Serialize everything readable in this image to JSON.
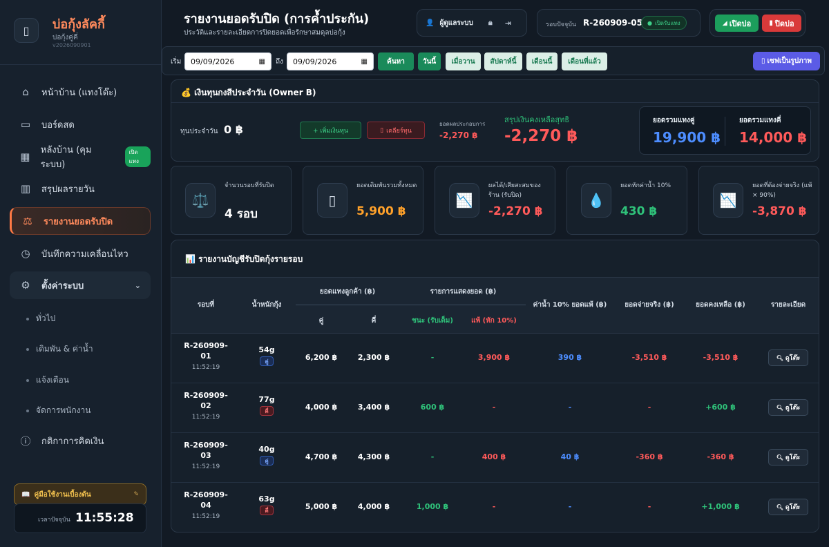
{
  "app": {
    "brand_name": "บ่อกุ้งลัคกี้",
    "brand_sub": "บ่อกุ้งคู่คี่",
    "version": "v2026090901"
  },
  "sidebar": {
    "items": [
      {
        "label": "หน้าบ้าน (แทงโต๊ะ)",
        "icon": "home-icon"
      },
      {
        "label": "บอร์ดสด",
        "icon": "monitor-icon"
      },
      {
        "label": "หลังบ้าน (คุมระบบ)",
        "icon": "layout-icon",
        "badge": "เปิดแทง"
      },
      {
        "label": "สรุปผลรายวัน",
        "icon": "bar-chart-icon"
      },
      {
        "label": "รายงานยอดรับปิด",
        "icon": "scale-icon"
      },
      {
        "label": "บันทึกความเคลื่อนไหว",
        "icon": "clock-icon"
      },
      {
        "label": "ตั้งค่าระบบ",
        "icon": "gear-icon"
      }
    ],
    "sub_items": [
      "ทั่วไป",
      "เดิมพัน & ค่าน้ำ",
      "แจ้งเตือน",
      "จัดการพนักงาน"
    ],
    "extra_item": {
      "label": "กติกาการคิดเงิน",
      "icon": "info-icon"
    },
    "guide_label": "คู่มือใช้งานเบื้องต้น",
    "clock_label": "เวลาปัจจุบัน",
    "clock_time": "11:55:28"
  },
  "header": {
    "title": "รายงานยอดรับปิด (การค้ำประกัน)",
    "subtitle": "ประวัติและรายละเอียดการปิดยอดเพื่อรักษาสมดุลบ่อกุ้ง",
    "user_label": "ผู้ดูแลระบบ",
    "round_label": "รอบปัจจุบัน",
    "round_id": "R-260909-05",
    "round_status": "เปิดรับแทง",
    "open_button": "เปิดบ่อ",
    "close_button": "ปิดบ่อ"
  },
  "filter": {
    "start_label": "เริ่ม",
    "start_date": "09/09/2026",
    "end_label": "ถึง",
    "end_date": "09/09/2026",
    "search_button": "ค้นหา",
    "quick": [
      "วันนี้",
      "เมื่อวาน",
      "สัปดาห์นี้",
      "เดือนนี้",
      "เดือนที่แล้ว"
    ],
    "save_button": "เซฟเป็นรูปภาพ"
  },
  "capital": {
    "title": "💰 เงินทุนกงสีประจำวัน (Owner B)",
    "daily_label": "ทุนประจำวัน",
    "daily_value": "0 ฿",
    "add_button": "+ เพิ่มเงินทุน",
    "clear_button": "เคลียร์ทุน",
    "op_label": "ยอดผลประกอบการ",
    "op_value": "-2,270 ฿",
    "net_label": "สรุปเงินคงเหลือสุทธิ",
    "net_value": "-2,270 ฿",
    "even_total_label": "ยอดรวมแทงคู่",
    "even_total_value": "19,900 ฿",
    "odd_total_label": "ยอดรวมแทงคี่",
    "odd_total_value": "14,000 ฿"
  },
  "stats": [
    {
      "label": "จำนวนรอบที่รับปิด",
      "value": "4 รอบ",
      "icon": "scale-icon"
    },
    {
      "label": "ยอดเดิมพันรวมทั้งหมด",
      "value": "5,900 ฿",
      "icon": "receipt-icon"
    },
    {
      "label": "ผลได้/เสียสะสมของร้าน (รับปิด)",
      "value": "-2,270 ฿",
      "icon": "chart-down-icon"
    },
    {
      "label": "ยอดหักค่าน้ำ 10%",
      "value": "430 ฿",
      "icon": "droplet-icon"
    },
    {
      "label": "ยอดที่ต้องจ่ายจริง (แพ้ × 90%)",
      "value": "-3,870 ฿",
      "icon": "chart-down-icon"
    }
  ],
  "table": {
    "title": "📊 รายงานบัญชีรับปิดกุ้งรายรอบ",
    "headers": {
      "round": "รอบที่",
      "weight": "น้ำหนักกุ้ง",
      "customer_group": "ยอดแทงลูกค้า (฿)",
      "even": "คู่",
      "odd": "คี่",
      "display_group": "รายการแสดงยอด (฿)",
      "win": "ชนะ (รับเต็ม)",
      "lose": "แพ้ (หัก 10%)",
      "commission": "ค่าน้ำ 10% ยอดแพ้ (฿)",
      "actual_pay": "ยอดจ่ายจริง (฿)",
      "balance": "ยอดคงเหลือ (฿)",
      "detail": "รายละเอียด"
    },
    "view_button": "ดูโต๊ะ",
    "rows": [
      {
        "round": "R-260909-",
        "round_no": "01",
        "time": "11:52:19",
        "weight": "54g",
        "parity": "คู่",
        "parity_type": "even",
        "even": "6,200 ฿",
        "odd": "2,300 ฿",
        "win": "-",
        "lose": "3,900 ฿",
        "commission": "390 ฿",
        "actual": "-3,510 ฿",
        "balance": "-3,510 ฿",
        "win_color": "green",
        "lose_color": "red",
        "comm_color": "blue",
        "actual_color": "red",
        "balance_color": "red"
      },
      {
        "round": "R-260909-",
        "round_no": "02",
        "time": "11:52:19",
        "weight": "77g",
        "parity": "คี่",
        "parity_type": "odd",
        "even": "4,000 ฿",
        "odd": "3,400 ฿",
        "win": "600 ฿",
        "lose": "-",
        "commission": "-",
        "actual": "-",
        "balance": "+600 ฿",
        "win_color": "green",
        "lose_color": "red",
        "comm_color": "blue",
        "actual_color": "red",
        "balance_color": "green"
      },
      {
        "round": "R-260909-",
        "round_no": "03",
        "time": "11:52:19",
        "weight": "40g",
        "parity": "คู่",
        "parity_type": "even",
        "even": "4,700 ฿",
        "odd": "4,300 ฿",
        "win": "-",
        "lose": "400 ฿",
        "commission": "40 ฿",
        "actual": "-360 ฿",
        "balance": "-360 ฿",
        "win_color": "green",
        "lose_color": "red",
        "comm_color": "blue",
        "actual_color": "red",
        "balance_color": "red"
      },
      {
        "round": "R-260909-",
        "round_no": "04",
        "time": "11:52:19",
        "weight": "63g",
        "parity": "คี่",
        "parity_type": "odd",
        "even": "5,000 ฿",
        "odd": "4,000 ฿",
        "win": "1,000 ฿",
        "lose": "-",
        "commission": "-",
        "actual": "-",
        "balance": "+1,000 ฿",
        "win_color": "green",
        "lose_color": "red",
        "comm_color": "blue",
        "actual_color": "red",
        "balance_color": "green"
      }
    ]
  },
  "colors": {
    "accent": "#ff7a45",
    "green": "#2fc27a",
    "red": "#ff5a5a",
    "blue": "#4d8dff",
    "orange": "#ffa12a"
  }
}
